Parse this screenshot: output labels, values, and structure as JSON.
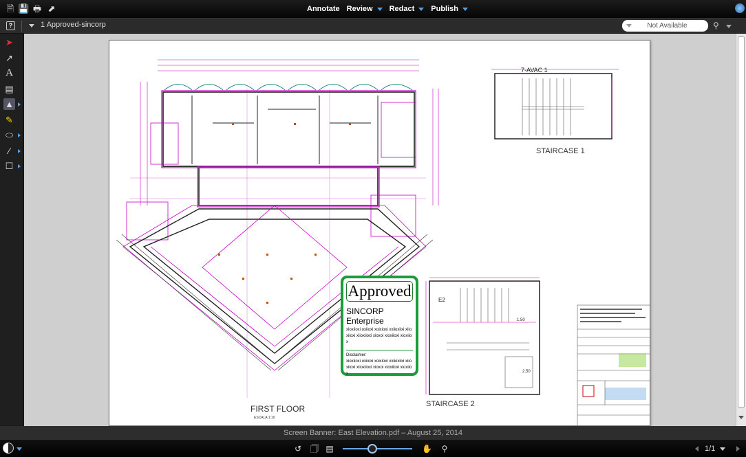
{
  "toolbar": {
    "icons": [
      "new-document-icon",
      "save-icon",
      "print-icon",
      "pointer-icon"
    ]
  },
  "menu": {
    "items": [
      {
        "label": "Annotate",
        "has_dropdown": false
      },
      {
        "label": "Review",
        "has_dropdown": true
      },
      {
        "label": "Redact",
        "has_dropdown": true
      },
      {
        "label": "Publish",
        "has_dropdown": true
      }
    ]
  },
  "tabbar": {
    "document_tab": "1 Approved-sincorp",
    "status_value": "Not Available"
  },
  "left_tools": [
    "select-tool-icon",
    "arrow-tool-icon",
    "text-tool-icon",
    "image-tool-icon",
    "stamp-tool-icon",
    "highlight-tool-icon",
    "shape-tool-icon",
    "line-tool-icon",
    "rectangle-tool-icon"
  ],
  "drawing": {
    "first_floor_label": "FIRST FLOOR",
    "first_floor_scale": "ESCALA 1:10",
    "staircase1_label": "STAIRCASE 1",
    "staircase2_label": "STAIRCASE 2",
    "room_top_label": "7-AVAC 1",
    "dim_e2": "E2",
    "dim_150": "1.50",
    "dim_250": "2.50"
  },
  "stamp": {
    "title": "Approved",
    "company": "SINCORP Enterprise",
    "body": "xioxiioxi oxiioxi xoixioxi xxiioxiixi xiioxiioxi xiioxiioxi xioxoi xioxiioxi xioxiiox",
    "disclaimer_label": "Disclaimer:",
    "disclaimer_body": "xioxiioxi oxiioxi xoixioxi xxiioxiixi xiioxiioxi xiioxiioxi xioxoi xioxiioxi xioxiiox",
    "border_color": "#1c9c3a"
  },
  "banner": {
    "text": "Screen Banner: East Elevation.pdf – August 25, 2014"
  },
  "bottombar": {
    "page_count": "1/1",
    "zoom_level": 0.43
  },
  "colors": {
    "accent": "#5aa0e0",
    "plan_magenta": "#c800c8",
    "plan_line": "#222222"
  }
}
